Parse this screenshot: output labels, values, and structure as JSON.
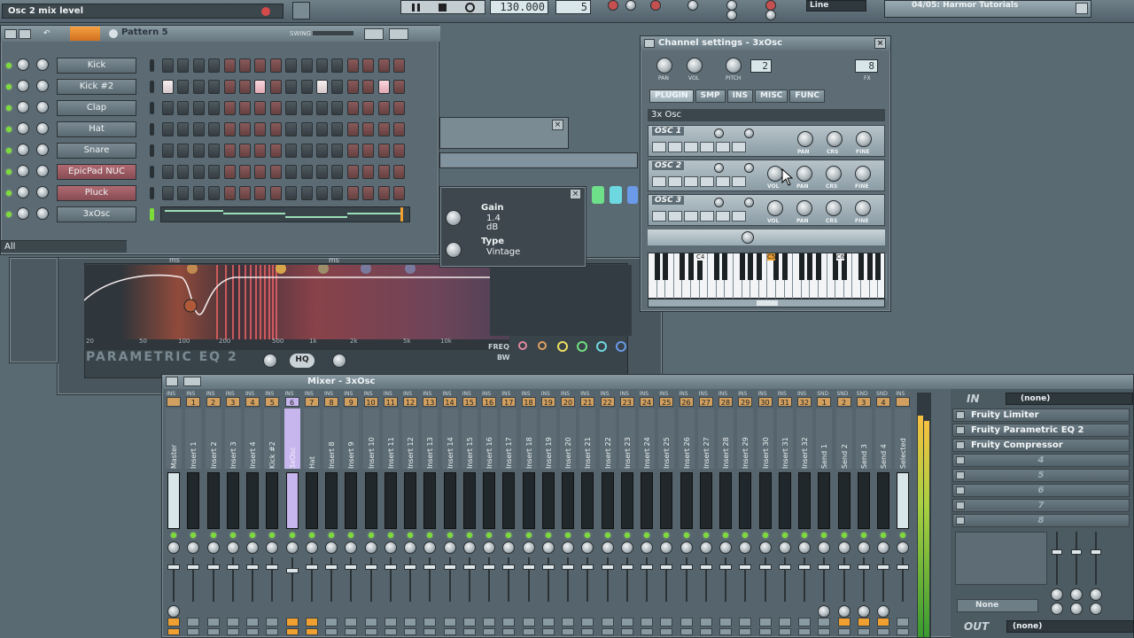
{
  "top": {
    "hint": "Osc 2 mix level",
    "tempo": "130.000",
    "pattern_num": "5",
    "snap": "Line",
    "tutorial": "04/05: Harmor Tutorials"
  },
  "step_seq": {
    "pattern": "Pattern 5",
    "swing": "SWING",
    "filter": "All",
    "channels": [
      {
        "name": "Kick"
      },
      {
        "name": "Kick #2"
      },
      {
        "name": "Clap"
      },
      {
        "name": "Hat"
      },
      {
        "name": "Snare"
      },
      {
        "name": "EpicPad NUC"
      },
      {
        "name": "Pluck"
      },
      {
        "name": "3xOsc"
      }
    ]
  },
  "channel_settings": {
    "title": "Channel settings - 3xOsc",
    "knob_labels": [
      "PAN",
      "VOL",
      "PITCH"
    ],
    "range": "2",
    "fx": "FX",
    "fx_value": "8",
    "tabs": [
      "PLUGIN",
      "SMP",
      "INS",
      "MISC",
      "FUNC"
    ],
    "plugin": "3x Osc",
    "osc": [
      {
        "label": "OSC 1",
        "knobs": [
          "PAN",
          "CRS",
          "FINE"
        ]
      },
      {
        "label": "OSC 2",
        "knobs": [
          "VOL",
          "PAN",
          "CRS",
          "FINE"
        ]
      },
      {
        "label": "OSC 3",
        "knobs": [
          "VOL",
          "PAN",
          "CRS",
          "FINE"
        ]
      }
    ],
    "keyboard_labels": [
      "C4",
      "C5",
      "C6"
    ]
  },
  "eq": {
    "gain_label": "Gain",
    "gain_value": "1.4",
    "gain_unit": "dB",
    "type_label": "Type",
    "type_value": "Vintage",
    "unit": "ms",
    "title": "PARAMETRIC EQ 2",
    "hq": "HQ",
    "freq": "FREQ",
    "bw": "BW",
    "freq_ticks": [
      "20",
      "50",
      "100",
      "200",
      "500",
      "1k",
      "2k",
      "5k",
      "10k"
    ]
  },
  "mixer": {
    "title": "Mixer - 3xOsc",
    "tracks": [
      "Master",
      "Insert 1",
      "Insert 2",
      "Insert 3",
      "Insert 4",
      "Kick #2",
      "3xOsc",
      "Hat",
      "Insert 8",
      "Insert 9",
      "Insert 10",
      "Insert 11",
      "Insert 12",
      "Insert 13",
      "Insert 14",
      "Insert 15",
      "Insert 16",
      "Insert 17",
      "Insert 18",
      "Insert 19",
      "Insert 20",
      "Insert 21",
      "Insert 22",
      "Insert 23",
      "Insert 24",
      "Insert 25",
      "Insert 26",
      "Insert 27",
      "Insert 28",
      "Insert 29",
      "Insert 30",
      "Insert 31",
      "Insert 32",
      "Send 1",
      "Send 2",
      "Send 3",
      "Send 4",
      "Selected"
    ],
    "numbers": [
      "",
      "1",
      "2",
      "3",
      "4",
      "5",
      "6",
      "7",
      "8",
      "9",
      "10",
      "11",
      "12",
      "13",
      "14",
      "15",
      "16",
      "17",
      "18",
      "19",
      "20",
      "21",
      "22",
      "23",
      "24",
      "25",
      "26",
      "27",
      "28",
      "29",
      "30",
      "31",
      "32",
      "1",
      "2",
      "3",
      "4",
      ""
    ],
    "ins": "INS",
    "snd": "SND",
    "in_label": "IN",
    "in_value": "(none)",
    "slots": [
      "Fruity Limiter",
      "Fruity Parametric EQ 2",
      "Fruity Compressor",
      "4",
      "5",
      "6",
      "7",
      "8"
    ],
    "none_label": "None",
    "out_label": "OUT",
    "out_value": "(none)"
  },
  "colors": {
    "panel": "#5a6a73",
    "accent_orange": "#f0a030",
    "selected_purple": "#c7b6ee",
    "led_green": "#7ddc3a"
  }
}
